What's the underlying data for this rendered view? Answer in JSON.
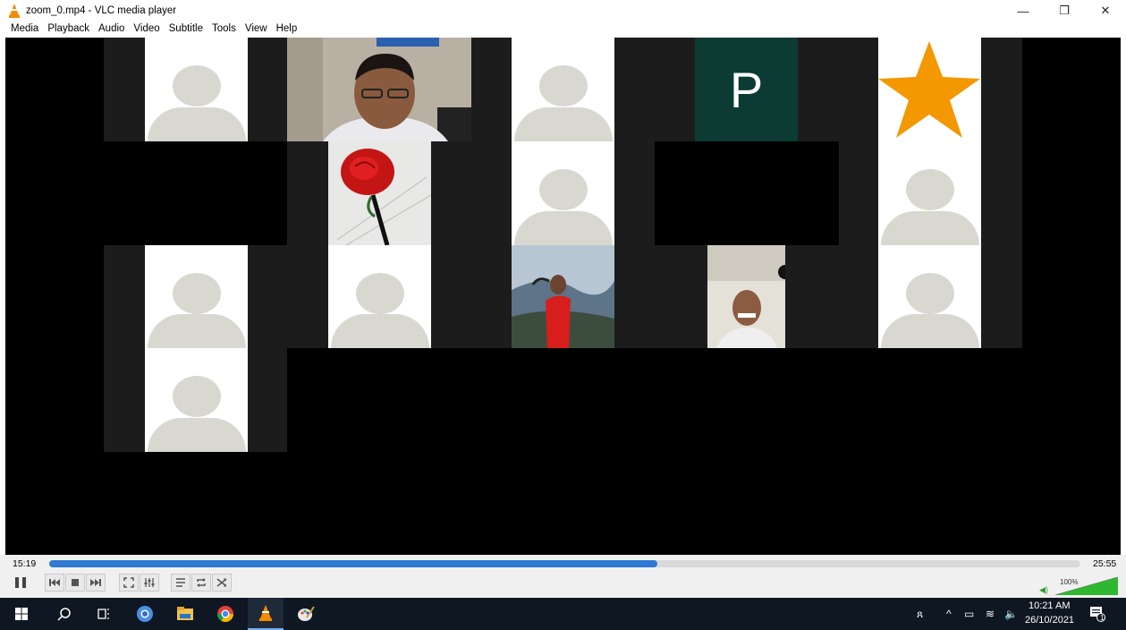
{
  "window": {
    "title": "zoom_0.mp4 - VLC media player",
    "min_icon": "—",
    "max_icon": "❐",
    "close_icon": "✕"
  },
  "menu": [
    "Media",
    "Playback",
    "Audio",
    "Video",
    "Subtitle",
    "Tools",
    "View",
    "Help"
  ],
  "video": {
    "participant_initial": "P",
    "tiles": [
      {
        "kind": "avatar"
      },
      {
        "kind": "video-man"
      },
      {
        "kind": "avatar"
      },
      {
        "kind": "initial"
      },
      {
        "kind": "star"
      },
      {
        "kind": "rose"
      },
      {
        "kind": "avatar"
      },
      {
        "kind": "avatar"
      },
      {
        "kind": "avatar"
      },
      {
        "kind": "avatar"
      },
      {
        "kind": "video-woman"
      },
      {
        "kind": "video-man2"
      },
      {
        "kind": "avatar"
      },
      {
        "kind": "avatar"
      }
    ]
  },
  "playback": {
    "current_time": "15:19",
    "total_time": "25:55",
    "progress": 0.59,
    "volume_label": "100%",
    "volume": 1.0
  },
  "controls": {
    "pause_icon": "pause-icon",
    "prev_icon": "skip-previous-icon",
    "stop_icon": "stop-icon",
    "next_icon": "skip-next-icon",
    "fullscreen_icon": "fullscreen-icon",
    "extended_icon": "equalizer-icon",
    "playlist_icon": "playlist-icon",
    "loop_icon": "loop-icon",
    "shuffle_icon": "shuffle-icon"
  },
  "taskbar": {
    "icons": [
      "windows-start-icon",
      "search-icon",
      "task-view-icon",
      "chrome-icon",
      "file-explorer-icon",
      "chrome-icon",
      "vlc-icon",
      "paint-icon"
    ],
    "clock_time": "10:21 AM",
    "clock_date": "26/10/2021",
    "notification_count": "1",
    "colors": {
      "taskbar": "#0f1722",
      "accent": "#2e7ad2",
      "vlc": "#f28c00"
    }
  }
}
